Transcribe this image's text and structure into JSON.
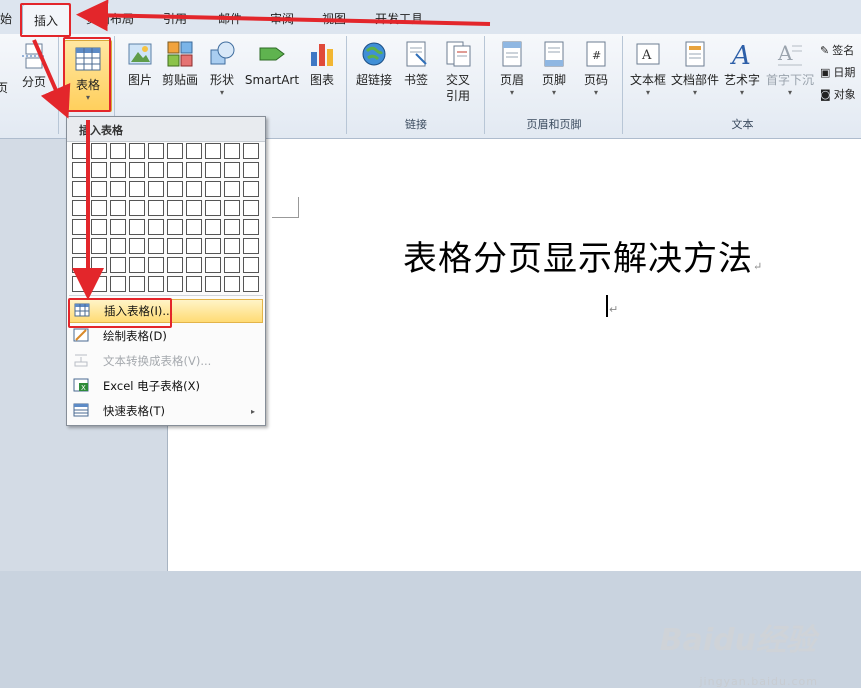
{
  "tabs": [
    {
      "label": "始"
    },
    {
      "label": "插入"
    },
    {
      "label": "页面布局"
    },
    {
      "label": "引用"
    },
    {
      "label": "邮件"
    },
    {
      "label": "审阅"
    },
    {
      "label": "视图"
    },
    {
      "label": "开发工具"
    }
  ],
  "ribbon": {
    "left_partial": {
      "label1": "页",
      "label2": "分页"
    },
    "table_button": {
      "label": "表格",
      "arrow": "▾"
    },
    "illustrations": [
      {
        "label": "图片"
      },
      {
        "label": "剪贴画"
      },
      {
        "label": "形状",
        "arrow": "▾"
      },
      {
        "label": "SmartArt"
      },
      {
        "label": "图表"
      }
    ],
    "links": {
      "group_label": "链接",
      "items": [
        {
          "label": "超链接"
        },
        {
          "label": "书签"
        },
        {
          "label": "交叉",
          "label2": "引用"
        }
      ]
    },
    "header_footer": {
      "group_label": "页眉和页脚",
      "items": [
        {
          "label": "页眉",
          "arrow": "▾"
        },
        {
          "label": "页脚",
          "arrow": "▾"
        },
        {
          "label": "页码",
          "arrow": "▾"
        }
      ]
    },
    "text": {
      "group_label": "文本",
      "items": [
        {
          "label": "文本框",
          "arrow": "▾"
        },
        {
          "label": "文档部件",
          "arrow": "▾"
        },
        {
          "label": "艺术字",
          "arrow": "▾"
        },
        {
          "label": "首字下沉",
          "arrow": "▾"
        }
      ],
      "side": [
        {
          "label": "签名"
        },
        {
          "label": "日期"
        },
        {
          "label": "对象"
        }
      ]
    }
  },
  "dropdown": {
    "header": "插入表格",
    "grid_cols": 10,
    "grid_rows": 8,
    "items": [
      {
        "label": "插入表格(I)...",
        "icon": "insert-table-icon"
      },
      {
        "label": "绘制表格(D)",
        "icon": "draw-table-icon"
      },
      {
        "label": "文本转换成表格(V)...",
        "icon": "convert-text-icon"
      },
      {
        "label": "Excel 电子表格(X)",
        "icon": "excel-icon"
      },
      {
        "label": "快速表格(T)",
        "icon": "quick-table-icon",
        "submenu": "▸"
      }
    ]
  },
  "document": {
    "title": "表格分页显示解决方法",
    "mark": "↵"
  },
  "watermark": {
    "brand": "Baidu经验",
    "url": "jingyan.baidu.com"
  }
}
